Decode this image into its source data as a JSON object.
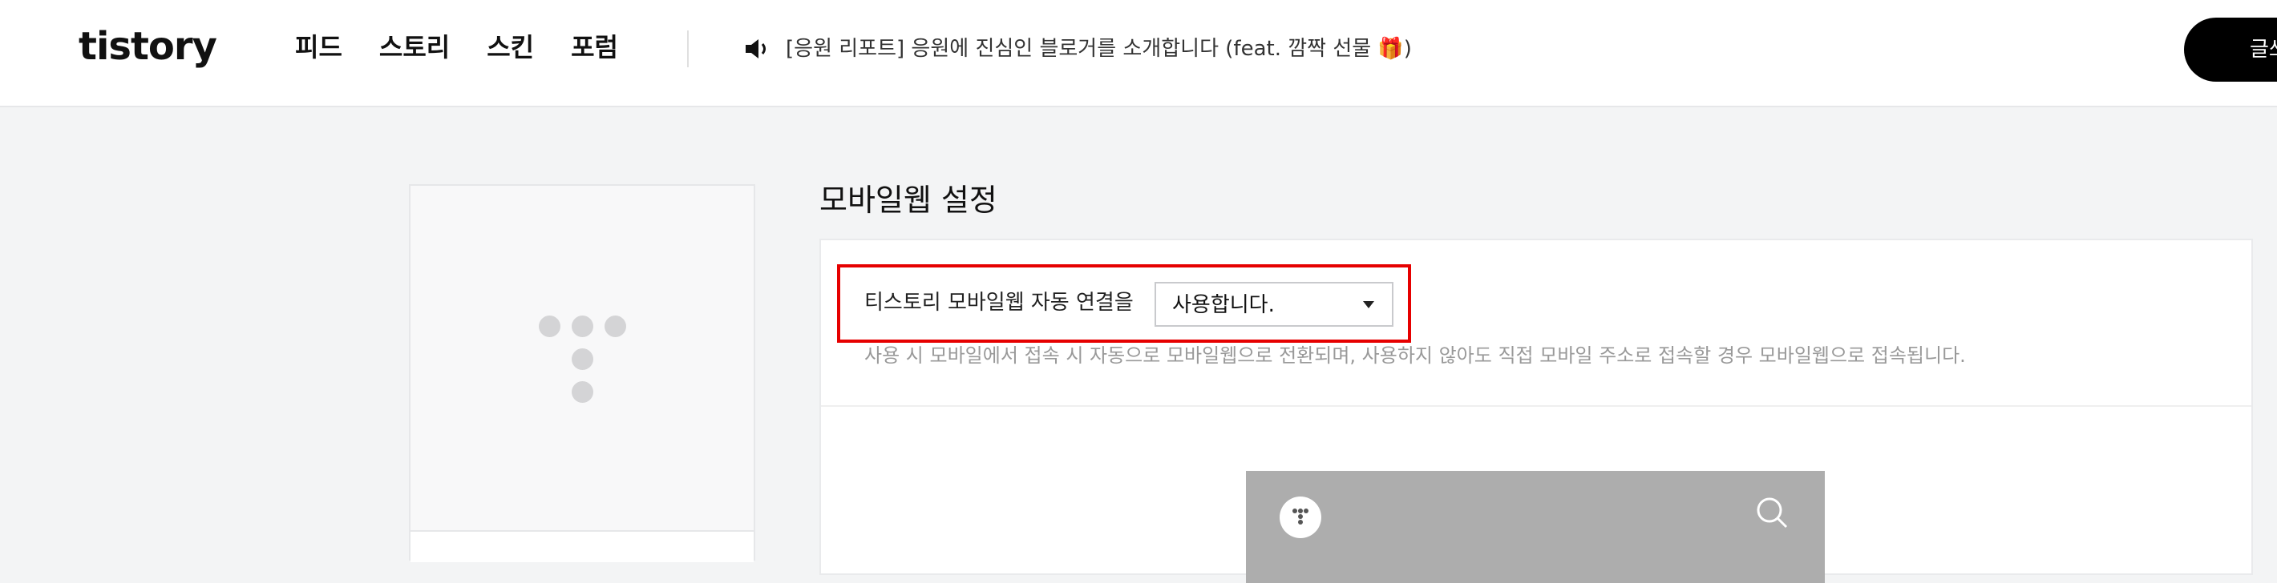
{
  "header": {
    "logo_text": "tistory",
    "nav": [
      {
        "label": "피드"
      },
      {
        "label": "스토리"
      },
      {
        "label": "스킨"
      },
      {
        "label": "포럼"
      }
    ],
    "notice_icon": "speaker-icon",
    "notice_text": "[응원 리포트] 응원에 진심인 블로거를 소개합니다 (feat. 깜짝 선물 🎁)",
    "write_button_label": "글쓰기"
  },
  "sidebar_card": {
    "logo_icon": "tistory-t-icon"
  },
  "main": {
    "section_title": "모바일웹 설정",
    "setting": {
      "label": "티스토리 모바일웹 자동 연결을",
      "select_value": "사용합니다.",
      "help_text": "사용 시 모바일에서 접속 시 자동으로 모바일웹으로 전환되며, 사용하지 않아도 직접 모바일 주소로 접속할 경우 모바일웹으로 접속됩니다."
    },
    "preview": {
      "logo_icon": "tistory-t-icon",
      "search_icon": "search-icon"
    }
  },
  "colors": {
    "highlight": "#e60000",
    "preview_bar": "#adadad",
    "button_bg": "#000000"
  }
}
